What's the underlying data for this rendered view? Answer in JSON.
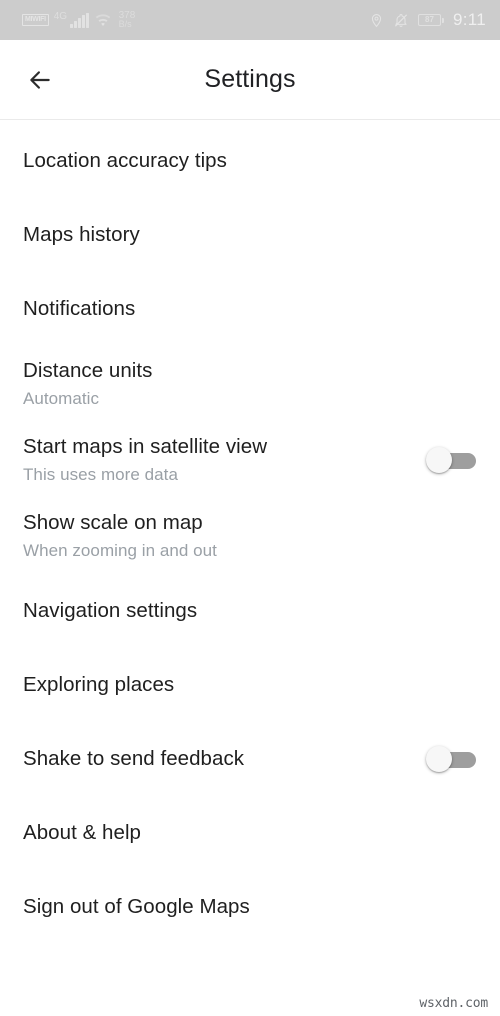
{
  "status_bar": {
    "sim_label": "MIWIFI",
    "network_type": "4G",
    "data_rate_value": "378",
    "data_rate_unit": "B/s",
    "battery_percent": "87",
    "time": "9:11",
    "icons": [
      "sim-badge",
      "signal-bars-icon",
      "wifi-icon",
      "location-pin-icon",
      "bell-off-icon",
      "battery-icon"
    ],
    "background_color": "#cccccc",
    "foreground_color": "#e4e4e4"
  },
  "app_bar": {
    "title": "Settings",
    "back_icon": "arrow-left-icon"
  },
  "settings": {
    "items": [
      {
        "title": "Location accuracy tips",
        "subtitle": "",
        "control": "none"
      },
      {
        "title": "Maps history",
        "subtitle": "",
        "control": "none"
      },
      {
        "title": "Notifications",
        "subtitle": "",
        "control": "none"
      },
      {
        "title": "Distance units",
        "subtitle": "Automatic",
        "control": "none"
      },
      {
        "title": "Start maps in satellite view",
        "subtitle": "This uses more data",
        "control": "toggle",
        "toggle_state": "off"
      },
      {
        "title": "Show scale on map",
        "subtitle": "When zooming in and out",
        "control": "none"
      },
      {
        "title": "Navigation settings",
        "subtitle": "",
        "control": "none"
      },
      {
        "title": "Exploring places",
        "subtitle": "",
        "control": "none"
      },
      {
        "title": "Shake to send feedback",
        "subtitle": "",
        "control": "toggle",
        "toggle_state": "off"
      },
      {
        "title": "About & help",
        "subtitle": "",
        "control": "none"
      },
      {
        "title": "Sign out of Google Maps",
        "subtitle": "",
        "control": "none"
      }
    ]
  },
  "watermark": {
    "text": "wsxdn.com"
  },
  "colors": {
    "page_background": "#ffffff",
    "title_text": "#1f1f1f",
    "subtitle_text": "#9aa0a6",
    "toggle_track_off": "#9e9e9e",
    "toggle_thumb_off": "#f7f7f7",
    "divider": "#eaeaea"
  }
}
